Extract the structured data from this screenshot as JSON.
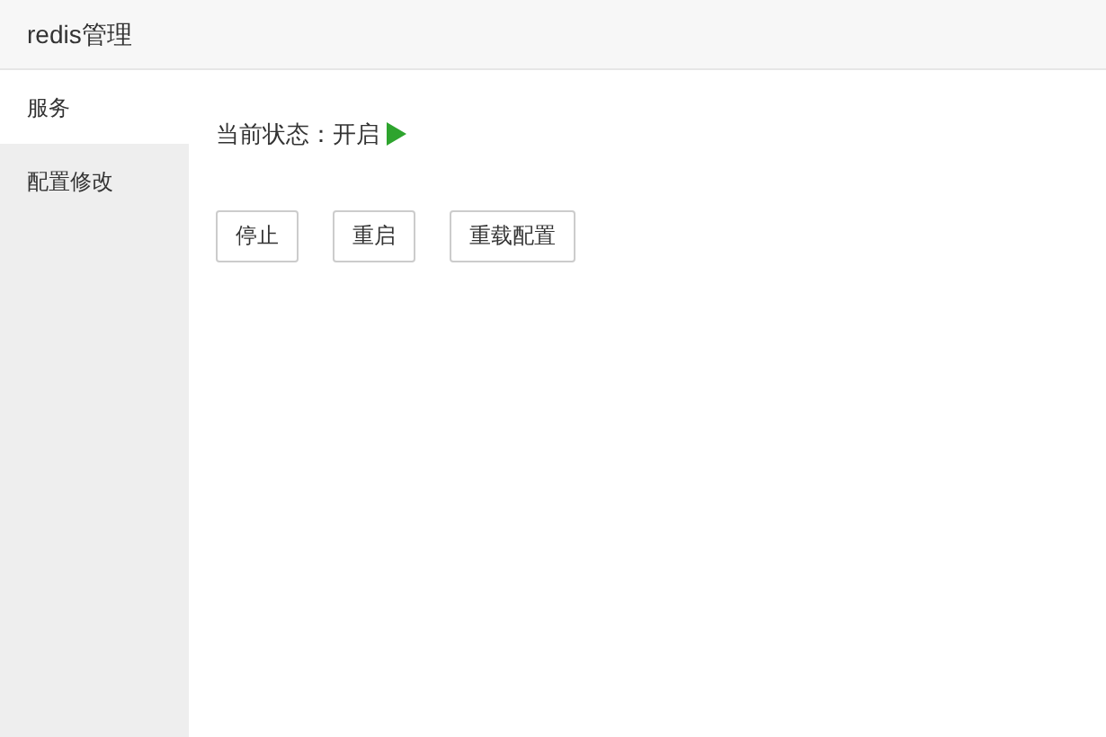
{
  "window": {
    "title": "redis管理"
  },
  "sidebar": {
    "items": [
      {
        "label": "服务",
        "selected": true
      },
      {
        "label": "配置修改",
        "selected": false
      }
    ]
  },
  "status": {
    "label": "当前状态：开启",
    "running": true
  },
  "buttons": [
    "停止",
    "重启",
    "重载配置"
  ]
}
